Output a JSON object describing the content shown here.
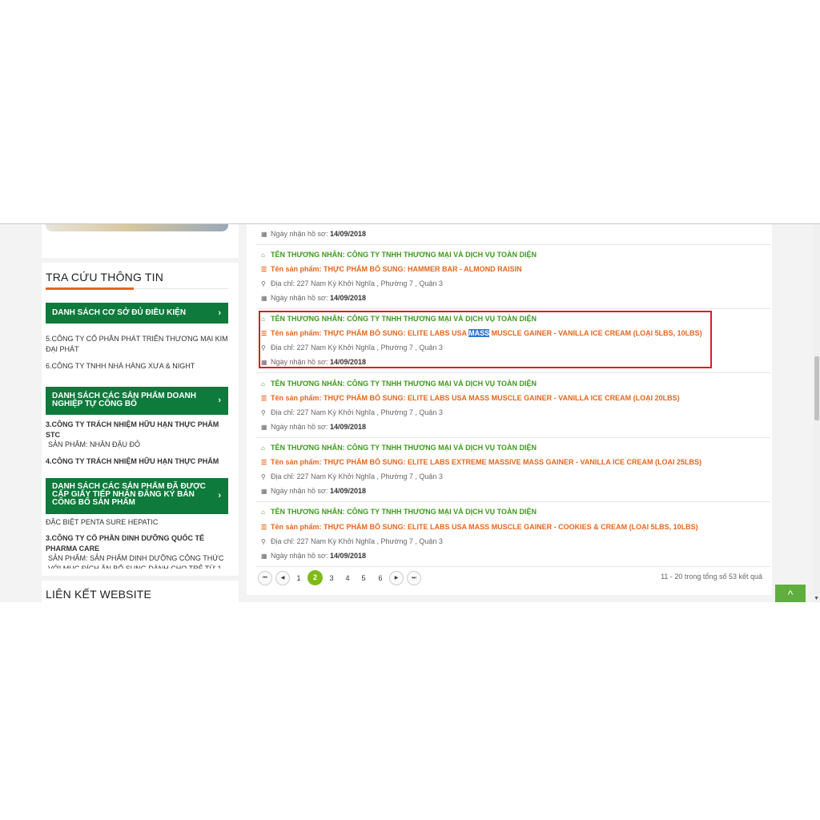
{
  "sidebar": {
    "section_title": "TRA CỨU THÔNG TIN",
    "btn1_label": "DANH SÁCH CƠ SỞ ĐỦ ĐIỀU KIỆN",
    "btn1_items": [
      "5.CÔNG TY CỔ PHẦN PHÁT TRIỂN THƯƠNG MẠI KIM ĐẠI PHÁT",
      "6.CÔNG TY TNHH NHÀ HÀNG XƯA & NIGHT"
    ],
    "btn2_label": "DANH SÁCH CÁC SẢN PHẨM DOANH NGHIỆP TỰ CÔNG BỐ",
    "btn2_item1": "3.CÔNG TY TRÁCH NHIỆM HỮU HẠN THỰC PHẨM STC",
    "btn2_item1_sub": "SẢN PHẨM: NHÂN ĐẬU ĐỎ",
    "btn2_item2": "4.CÔNG TY TRÁCH NHIỆM HỮU HẠN THỰC PHẨM",
    "btn3_label": "DANH SÁCH CÁC SẢN PHẨM ĐÃ ĐƯỢC CẤP GIẤY TIẾP NHẬN ĐĂNG KÝ BẢN CÔNG BỐ SẢN PHẨM",
    "btn3_item0": "ĐẶC BIỆT PENTA SURE HEPATIC",
    "btn3_item1": "3.CÔNG TY CỔ PHẦN DINH DƯỠNG QUỐC TẾ PHARMA CARE",
    "btn3_item1_sub": "SẢN PHẨM: SẢN PHẨM DINH DƯỠNG CÔNG THỨC VỚI MỤC ĐÍCH ĂN BỔ SUNG DÀNH CHO TRẺ TỪ 1",
    "chevron": "›",
    "links_title": "LIÊN KẾT WEBSITE"
  },
  "results": {
    "top_date_label": "Ngày nhận hồ sơ:",
    "top_date_value": "14/09/2018",
    "items": [
      {
        "merchant": "TÊN THƯƠNG NHÂN: CÔNG TY TNHH THƯƠNG MẠI VÀ DỊCH VỤ TOÀN DIỆN",
        "product": "Tên sản phẩm: THỰC PHẨM BỔ SUNG: HAMMER BAR - ALMOND RAISIN",
        "address": "Địa chỉ: 227 Nam Kỳ Khởi Nghĩa , Phường 7 , Quận 3",
        "date_label": "Ngày nhận hồ sơ:",
        "date_value": "14/09/2018"
      },
      {
        "merchant": "TÊN THƯƠNG NHÂN: CÔNG TY TNHH THƯƠNG MẠI VÀ DỊCH VỤ TOÀN DIỆN",
        "product_pre": "Tên sản phẩm: THỰC PHẨM BỔ SUNG: ELITE LABS USA ",
        "product_hl": "MASS",
        "product_post": " MUSCLE GAINER - VANILLA ICE CREAM (LOẠI 5LBS, 10LBS)",
        "address": "Địa chỉ: 227 Nam Kỳ Khởi Nghĩa , Phường 7 , Quận 3",
        "date_label": "Ngày nhận hồ sơ:",
        "date_value": "14/09/2018"
      },
      {
        "merchant": "TÊN THƯƠNG NHÂN: CÔNG TY TNHH THƯƠNG MẠI VÀ DỊCH VỤ TOÀN DIỆN",
        "product": "Tên sản phẩm: THỰC PHẨM BỔ SUNG: ELITE LABS USA MASS MUSCLE GAINER - VANILLA ICE CREAM (LOẠI 20LBS)",
        "address": "Địa chỉ: 227 Nam Kỳ Khởi Nghĩa , Phường 7 , Quận 3",
        "date_label": "Ngày nhận hồ sơ:",
        "date_value": "14/09/2018"
      },
      {
        "merchant": "TÊN THƯƠNG NHÂN: CÔNG TY TNHH THƯƠNG MẠI VÀ DỊCH VỤ TOÀN DIỆN",
        "product": "Tên sản phẩm: THỰC PHẨM BỔ SUNG: ELITE LABS EXTREME MASSIVE MASS GAINER - VANILLA ICE CREAM (LOẠI 25LBS)",
        "address": "Địa chỉ: 227 Nam Kỳ Khởi Nghĩa , Phường 7 , Quận 3",
        "date_label": "Ngày nhận hồ sơ:",
        "date_value": "14/09/2018"
      },
      {
        "merchant": "TÊN THƯƠNG NHÂN: CÔNG TY TNHH THƯƠNG MẠI VÀ DỊCH VỤ TOÀN DIỆN",
        "product": "Tên sản phẩm: THỰC PHẨM BỔ SUNG: ELITE LABS USA MASS MUSCLE GAINER - COOKIES & CREAM (LOẠI 5LBS, 10LBS)",
        "address": "Địa chỉ: 227 Nam Kỳ Khởi Nghĩa , Phường 7 , Quận 3",
        "date_label": "Ngày nhận hồ sơ:",
        "date_value": "14/09/2018"
      }
    ]
  },
  "pagination": {
    "first": "⏮",
    "prev": "◀",
    "next": "▶",
    "last": "⏭",
    "pages": [
      "1",
      "2",
      "3",
      "4",
      "5",
      "6"
    ],
    "current": "2",
    "info": "11 - 20 trong tổng số 53 kết quả"
  },
  "icons": {
    "home": "⌂",
    "list": "☰",
    "pin": "⚲",
    "calendar": "▦",
    "back_to_top": "^"
  },
  "colors": {
    "brand_green": "#0e7a3c",
    "merchant_green": "#3e9a1d",
    "product_orange": "#e8661b",
    "active_page": "#80b91b",
    "highlight_border": "#d51f26",
    "selection": "#2f7ad6"
  }
}
